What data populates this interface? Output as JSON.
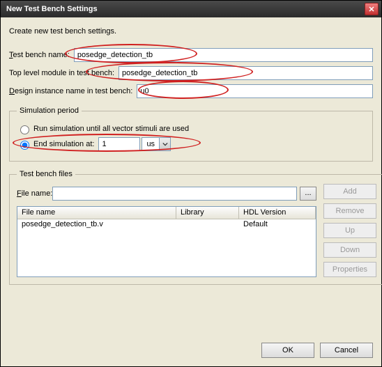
{
  "window": {
    "title": "New Test Bench Settings"
  },
  "intro": "Create new test bench settings.",
  "fields": {
    "tbname_label_pre": "T",
    "tbname_label_rest": "est bench name:",
    "tbname_value": "posedge_detection_tb",
    "toplevel_label": "Top level module in test bench:",
    "toplevel_value": "posedge_detection_tb",
    "design_label_pre": "D",
    "design_label_rest": "esign instance name in test bench:",
    "design_value": "u0"
  },
  "sim": {
    "legend": "Simulation period",
    "opt_run_label": "Run simulation until all vector stimuli are used",
    "opt_end_label": "End simulation at:",
    "end_value": "1",
    "unit": "us"
  },
  "files": {
    "legend": "Test bench files",
    "filename_label_pre": "F",
    "filename_label_rest": "ile name:",
    "filename_value": "",
    "browse": "...",
    "cols": {
      "c1": "File name",
      "c2": "Library",
      "c3": "HDL Version"
    },
    "rows": [
      {
        "name": "posedge_detection_tb.v",
        "lib": "",
        "hdl": "Default"
      }
    ],
    "buttons": {
      "add": "Add",
      "remove": "Remove",
      "up": "Up",
      "down": "Down",
      "props": "Properties"
    }
  },
  "bottom": {
    "ok": "OK",
    "cancel": "Cancel"
  }
}
